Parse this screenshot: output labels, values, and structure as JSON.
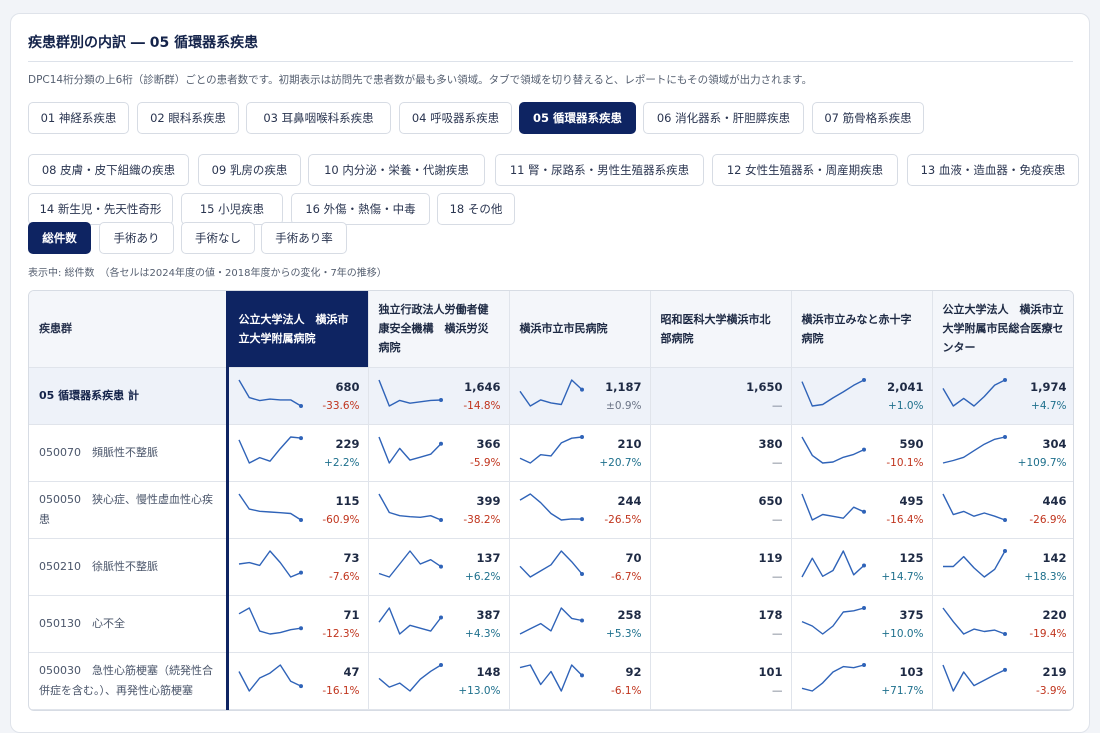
{
  "title": "疾患群別の内訳 ― 05 循環器系疾患",
  "description": "DPC14桁分類の上6桁（診断群）ごとの患者数です。初期表示は訪問先で患者数が最も多い領域。タブで領域を切り替えると、レポートにもその領域が出力されます。",
  "tabs": [
    {
      "label": "01 神経系疾患"
    },
    {
      "label": "02 眼科系疾患"
    },
    {
      "label": "03 耳鼻咽喉科系疾患"
    },
    {
      "label": "04 呼吸器系疾患"
    },
    {
      "label": "05 循環器系疾患",
      "active": true
    },
    {
      "label": "06 消化器系・肝胆膵疾患"
    },
    {
      "label": "07 筋骨格系疾患"
    },
    {
      "label": "08 皮膚・皮下組織の疾患"
    },
    {
      "label": "09 乳房の疾患"
    },
    {
      "label": "10 内分泌・栄養・代謝疾患"
    },
    {
      "label": "11 腎・尿路系・男性生殖器系疾患"
    },
    {
      "label": "12 女性生殖器系・周産期疾患"
    },
    {
      "label": "13 血液・造血器・免疫疾患"
    },
    {
      "label": "14 新生児・先天性奇形"
    },
    {
      "label": "15 小児疾患"
    },
    {
      "label": "16 外傷・熱傷・中毒"
    },
    {
      "label": "18 その他"
    }
  ],
  "metrics": [
    {
      "label": "総件数",
      "active": true
    },
    {
      "label": "手術あり"
    },
    {
      "label": "手術なし"
    },
    {
      "label": "手術あり率"
    }
  ],
  "mode_text": "表示中: 総件数　（各セルは2024年度の値・2018年度からの変化・7年の推移）",
  "table": {
    "first_header": "疾患群",
    "hospitals": [
      "公立大学法人　横浜市立大学附属病院",
      "独立行政法人労働者健康安全機構　横浜労災病院",
      "横浜市立市民病院",
      "昭和医科大学横浜市北部病院",
      "横浜市立みなと赤十字病院",
      "公立大学法人　横浜市立大学附属市民総合医療センター"
    ],
    "highlight_index": 0,
    "line_color": "#2f63b8",
    "rows": [
      {
        "name": "05 循環器系疾患 計",
        "total": true,
        "cells": [
          {
            "value": "680",
            "change": "-33.6%",
            "trend": [
              1020,
              790,
              750,
              770,
              760,
              760,
              680
            ]
          },
          {
            "value": "1,646",
            "change": "-14.8%",
            "trend": [
              1930,
              1560,
              1640,
              1600,
              1620,
              1640,
              1646
            ]
          },
          {
            "value": "1,187",
            "change": "±0.9%",
            "trend": [
              1176,
              1080,
              1120,
              1100,
              1090,
              1250,
              1187
            ]
          },
          {
            "value": "1,650",
            "change": "—",
            "trend": []
          },
          {
            "value": "2,041",
            "change": "+1.0%",
            "trend": [
              2020,
              1690,
              1710,
              1800,
              1880,
              1970,
              2041
            ]
          },
          {
            "value": "1,974",
            "change": "+4.7%",
            "trend": [
              1885,
              1700,
              1780,
              1700,
              1800,
              1920,
              1974
            ]
          }
        ]
      },
      {
        "name": "050070　頻脈性不整脈",
        "cells": [
          {
            "value": "229",
            "change": "+2.2%",
            "trend": [
              224,
              160,
              175,
              165,
              200,
              232,
              229
            ]
          },
          {
            "value": "366",
            "change": "-5.9%",
            "trend": [
              389,
              300,
              350,
              310,
              320,
              330,
              366
            ]
          },
          {
            "value": "210",
            "change": "+20.7%",
            "trend": [
              174,
              166,
              180,
              178,
              200,
              208,
              210
            ]
          },
          {
            "value": "380",
            "change": "—",
            "trend": []
          },
          {
            "value": "590",
            "change": "-10.1%",
            "trend": [
              656,
              560,
              520,
              525,
              550,
              565,
              590
            ]
          },
          {
            "value": "304",
            "change": "+109.7%",
            "trend": [
              145,
              160,
              180,
              220,
              260,
              290,
              304
            ]
          }
        ]
      },
      {
        "name": "050050　狭心症、慢性虚血性心疾患",
        "cells": [
          {
            "value": "115",
            "change": "-60.9%",
            "trend": [
              294,
              190,
              175,
              170,
              165,
              160,
              115
            ]
          },
          {
            "value": "399",
            "change": "-38.2%",
            "trend": [
              646,
              470,
              440,
              430,
              425,
              440,
              399
            ]
          },
          {
            "value": "244",
            "change": "-26.5%",
            "trend": [
              332,
              360,
              320,
              270,
              240,
              245,
              244
            ]
          },
          {
            "value": "650",
            "change": "—",
            "trend": []
          },
          {
            "value": "495",
            "change": "-16.4%",
            "trend": [
              592,
              450,
              480,
              470,
              460,
              520,
              495
            ]
          },
          {
            "value": "446",
            "change": "-26.9%",
            "trend": [
              610,
              480,
              500,
              470,
              490,
              470,
              446
            ]
          }
        ]
      },
      {
        "name": "050210　徐脈性不整脈",
        "cells": [
          {
            "value": "73",
            "change": "-7.6%",
            "trend": [
              79,
              80,
              78,
              88,
              80,
              70,
              73
            ]
          },
          {
            "value": "137",
            "change": "+6.2%",
            "trend": [
              129,
              125,
              140,
              155,
              140,
              145,
              137
            ]
          },
          {
            "value": "70",
            "change": "-6.7%",
            "trend": [
              75,
              68,
              72,
              76,
              85,
              78,
              70
            ]
          },
          {
            "value": "119",
            "change": "—",
            "trend": []
          },
          {
            "value": "125",
            "change": "+14.7%",
            "trend": [
              109,
              135,
              110,
              118,
              145,
              112,
              125
            ]
          },
          {
            "value": "142",
            "change": "+18.3%",
            "trend": [
              120,
              120,
              134,
              118,
              105,
              116,
              142
            ]
          }
        ]
      },
      {
        "name": "050130　心不全",
        "cells": [
          {
            "value": "71",
            "change": "-12.3%",
            "trend": [
              81,
              85,
              69,
              67,
              68,
              70,
              71
            ]
          },
          {
            "value": "387",
            "change": "+4.3%",
            "trend": [
              371,
              420,
              330,
              360,
              350,
              340,
              387
            ]
          },
          {
            "value": "258",
            "change": "+5.3%",
            "trend": [
              245,
              250,
              255,
              248,
              270,
              260,
              258
            ]
          },
          {
            "value": "178",
            "change": "—",
            "trend": []
          },
          {
            "value": "375",
            "change": "+10.0%",
            "trend": [
              341,
              330,
              310,
              330,
              365,
              368,
              375
            ]
          },
          {
            "value": "220",
            "change": "-19.4%",
            "trend": [
              273,
              245,
              220,
              230,
              225,
              228,
              220
            ]
          }
        ]
      },
      {
        "name": "050030　急性心筋梗塞（続発性合併症を含む。）、再発性心筋梗塞",
        "cells": [
          {
            "value": "47",
            "change": "-16.1%",
            "trend": [
              56,
              44,
              52,
              55,
              60,
              50,
              47
            ]
          },
          {
            "value": "148",
            "change": "+13.0%",
            "trend": [
              131,
              120,
              125,
              115,
              130,
              140,
              148
            ]
          },
          {
            "value": "92",
            "change": "-6.1%",
            "trend": [
              98,
              100,
              85,
              95,
              80,
              100,
              92
            ]
          },
          {
            "value": "101",
            "change": "—",
            "trend": []
          },
          {
            "value": "103",
            "change": "+71.7%",
            "trend": [
              60,
              55,
              70,
              90,
              100,
              98,
              103
            ]
          },
          {
            "value": "219",
            "change": "-3.9%",
            "trend": [
              228,
              180,
              215,
              190,
              200,
              210,
              219
            ]
          }
        ]
      }
    ]
  }
}
